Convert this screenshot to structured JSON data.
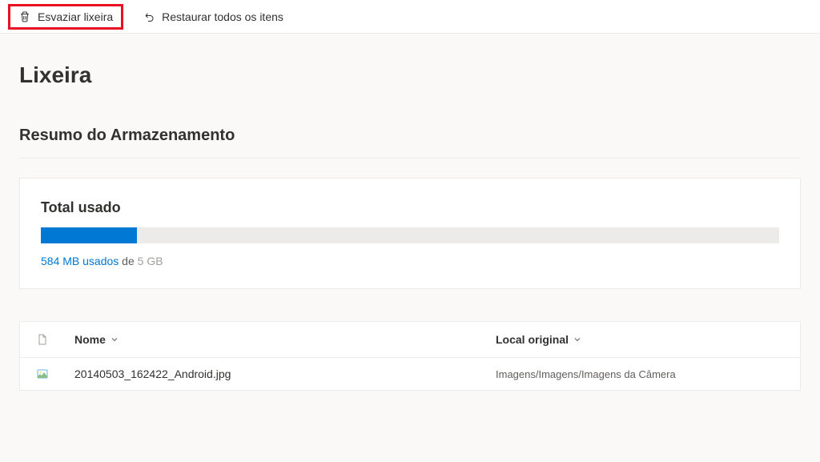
{
  "toolbar": {
    "empty_bin_label": "Esvaziar lixeira",
    "restore_all_label": "Restaurar todos os itens"
  },
  "page": {
    "title": "Lixeira",
    "storage_section_title": "Resumo do Armazenamento"
  },
  "storage": {
    "label": "Total usado",
    "used_text": "584 MB usados",
    "of_text": " de ",
    "total_text": "5 GB",
    "percent_used": 13
  },
  "table": {
    "headers": {
      "name": "Nome",
      "location": "Local original"
    },
    "rows": [
      {
        "name": "20140503_162422_Android.jpg",
        "location": "Imagens/Imagens/Imagens da Câmera"
      }
    ]
  }
}
